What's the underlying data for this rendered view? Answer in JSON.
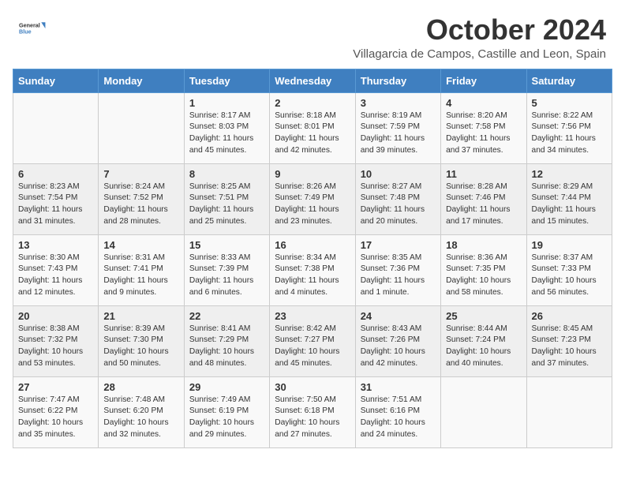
{
  "header": {
    "logo_line1": "General",
    "logo_line2": "Blue",
    "month_title": "October 2024",
    "subtitle": "Villagarcia de Campos, Castille and Leon, Spain"
  },
  "days_of_week": [
    "Sunday",
    "Monday",
    "Tuesday",
    "Wednesday",
    "Thursday",
    "Friday",
    "Saturday"
  ],
  "weeks": [
    [
      {
        "day": "",
        "info": ""
      },
      {
        "day": "",
        "info": ""
      },
      {
        "day": "1",
        "info": "Sunrise: 8:17 AM\nSunset: 8:03 PM\nDaylight: 11 hours and 45 minutes."
      },
      {
        "day": "2",
        "info": "Sunrise: 8:18 AM\nSunset: 8:01 PM\nDaylight: 11 hours and 42 minutes."
      },
      {
        "day": "3",
        "info": "Sunrise: 8:19 AM\nSunset: 7:59 PM\nDaylight: 11 hours and 39 minutes."
      },
      {
        "day": "4",
        "info": "Sunrise: 8:20 AM\nSunset: 7:58 PM\nDaylight: 11 hours and 37 minutes."
      },
      {
        "day": "5",
        "info": "Sunrise: 8:22 AM\nSunset: 7:56 PM\nDaylight: 11 hours and 34 minutes."
      }
    ],
    [
      {
        "day": "6",
        "info": "Sunrise: 8:23 AM\nSunset: 7:54 PM\nDaylight: 11 hours and 31 minutes."
      },
      {
        "day": "7",
        "info": "Sunrise: 8:24 AM\nSunset: 7:52 PM\nDaylight: 11 hours and 28 minutes."
      },
      {
        "day": "8",
        "info": "Sunrise: 8:25 AM\nSunset: 7:51 PM\nDaylight: 11 hours and 25 minutes."
      },
      {
        "day": "9",
        "info": "Sunrise: 8:26 AM\nSunset: 7:49 PM\nDaylight: 11 hours and 23 minutes."
      },
      {
        "day": "10",
        "info": "Sunrise: 8:27 AM\nSunset: 7:48 PM\nDaylight: 11 hours and 20 minutes."
      },
      {
        "day": "11",
        "info": "Sunrise: 8:28 AM\nSunset: 7:46 PM\nDaylight: 11 hours and 17 minutes."
      },
      {
        "day": "12",
        "info": "Sunrise: 8:29 AM\nSunset: 7:44 PM\nDaylight: 11 hours and 15 minutes."
      }
    ],
    [
      {
        "day": "13",
        "info": "Sunrise: 8:30 AM\nSunset: 7:43 PM\nDaylight: 11 hours and 12 minutes."
      },
      {
        "day": "14",
        "info": "Sunrise: 8:31 AM\nSunset: 7:41 PM\nDaylight: 11 hours and 9 minutes."
      },
      {
        "day": "15",
        "info": "Sunrise: 8:33 AM\nSunset: 7:39 PM\nDaylight: 11 hours and 6 minutes."
      },
      {
        "day": "16",
        "info": "Sunrise: 8:34 AM\nSunset: 7:38 PM\nDaylight: 11 hours and 4 minutes."
      },
      {
        "day": "17",
        "info": "Sunrise: 8:35 AM\nSunset: 7:36 PM\nDaylight: 11 hours and 1 minute."
      },
      {
        "day": "18",
        "info": "Sunrise: 8:36 AM\nSunset: 7:35 PM\nDaylight: 10 hours and 58 minutes."
      },
      {
        "day": "19",
        "info": "Sunrise: 8:37 AM\nSunset: 7:33 PM\nDaylight: 10 hours and 56 minutes."
      }
    ],
    [
      {
        "day": "20",
        "info": "Sunrise: 8:38 AM\nSunset: 7:32 PM\nDaylight: 10 hours and 53 minutes."
      },
      {
        "day": "21",
        "info": "Sunrise: 8:39 AM\nSunset: 7:30 PM\nDaylight: 10 hours and 50 minutes."
      },
      {
        "day": "22",
        "info": "Sunrise: 8:41 AM\nSunset: 7:29 PM\nDaylight: 10 hours and 48 minutes."
      },
      {
        "day": "23",
        "info": "Sunrise: 8:42 AM\nSunset: 7:27 PM\nDaylight: 10 hours and 45 minutes."
      },
      {
        "day": "24",
        "info": "Sunrise: 8:43 AM\nSunset: 7:26 PM\nDaylight: 10 hours and 42 minutes."
      },
      {
        "day": "25",
        "info": "Sunrise: 8:44 AM\nSunset: 7:24 PM\nDaylight: 10 hours and 40 minutes."
      },
      {
        "day": "26",
        "info": "Sunrise: 8:45 AM\nSunset: 7:23 PM\nDaylight: 10 hours and 37 minutes."
      }
    ],
    [
      {
        "day": "27",
        "info": "Sunrise: 7:47 AM\nSunset: 6:22 PM\nDaylight: 10 hours and 35 minutes."
      },
      {
        "day": "28",
        "info": "Sunrise: 7:48 AM\nSunset: 6:20 PM\nDaylight: 10 hours and 32 minutes."
      },
      {
        "day": "29",
        "info": "Sunrise: 7:49 AM\nSunset: 6:19 PM\nDaylight: 10 hours and 29 minutes."
      },
      {
        "day": "30",
        "info": "Sunrise: 7:50 AM\nSunset: 6:18 PM\nDaylight: 10 hours and 27 minutes."
      },
      {
        "day": "31",
        "info": "Sunrise: 7:51 AM\nSunset: 6:16 PM\nDaylight: 10 hours and 24 minutes."
      },
      {
        "day": "",
        "info": ""
      },
      {
        "day": "",
        "info": ""
      }
    ]
  ]
}
